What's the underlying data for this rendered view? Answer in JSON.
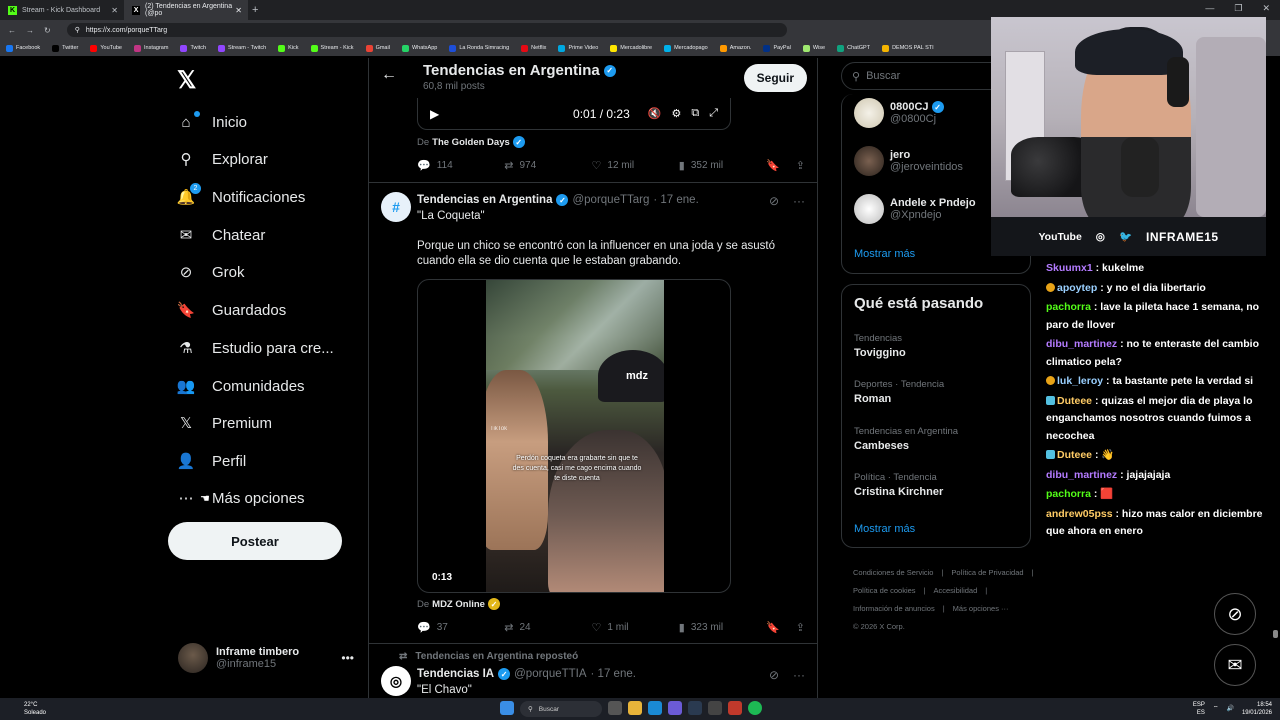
{
  "browser": {
    "tabs": [
      {
        "label": "Stream - Kick Dashboard",
        "active": false
      },
      {
        "label": "(2) Tendencias en Argentina (@po",
        "active": true
      }
    ],
    "url": "https://x.com/porqueTTarg",
    "bookmarks": [
      "Facebook",
      "Twitter",
      "YouTube",
      "Instagram",
      "Twitch",
      "Stream - Twitch",
      "Kick",
      "Stream - Kick",
      "Gmail",
      "WhatsApp",
      "La Ronda Simracing",
      "Netflix",
      "Prime Video",
      "Mercadolibre",
      "Mercadopago",
      "Amazon.",
      "PayPal",
      "Wise",
      "ChatGPT",
      "DEMOS PAL STI"
    ]
  },
  "nav": {
    "items": [
      {
        "label": "Inicio",
        "icon": "home-icon"
      },
      {
        "label": "Explorar",
        "icon": "search-icon"
      },
      {
        "label": "Notificaciones",
        "icon": "bell-icon",
        "badge": "2"
      },
      {
        "label": "Chatear",
        "icon": "mail-icon"
      },
      {
        "label": "Grok",
        "icon": "grok-icon"
      },
      {
        "label": "Guardados",
        "icon": "bookmark-icon"
      },
      {
        "label": "Estudio para cre...",
        "icon": "flask-icon"
      },
      {
        "label": "Comunidades",
        "icon": "people-icon"
      },
      {
        "label": "Premium",
        "icon": "x-icon"
      },
      {
        "label": "Perfil",
        "icon": "person-icon"
      },
      {
        "label": "Más opciones",
        "icon": "more-circle-icon"
      }
    ],
    "post_button": "Postear",
    "profile": {
      "name": "Inframe timbero",
      "handle": "@inframe15"
    }
  },
  "header": {
    "title": "Tendencias en Argentina",
    "subtitle": "60,8 mil posts",
    "follow": "Seguir"
  },
  "video1": {
    "time": "0:01 / 0:23",
    "source_prefix": "De",
    "source": "The Golden Days",
    "stats": {
      "replies": "114",
      "reposts": "974",
      "likes": "12 mil",
      "views": "352 mil"
    }
  },
  "tweet2": {
    "name": "Tendencias en Argentina",
    "handle": "@porqueTTarg",
    "date": "· 17 ene.",
    "line1": "\"La Coqueta\"",
    "line2": "Porque un chico se encontró con la influencer en una joda y se asustó cuando ella se dio cuenta que le estaban grabando.",
    "media": {
      "duration": "0:13",
      "overlay_logo": "mdz",
      "caption": "Perdón coqueta era grabarte sin que te des cuenta, casi me cago encima cuando te diste cuenta",
      "tiktok": "TikTok"
    },
    "source_prefix": "De",
    "source": "MDZ Online",
    "stats": {
      "replies": "37",
      "reposts": "24",
      "likes": "1 mil",
      "views": "323 mil"
    }
  },
  "tweet3": {
    "repost_label": "Tendencias en Argentina reposteó",
    "name": "Tendencias IA",
    "handle": "@porqueTTIA",
    "date": "· 17 ene.",
    "line1": "\"El Chavo\""
  },
  "right": {
    "search_placeholder": "Buscar",
    "who": [
      {
        "name": "0800CJ",
        "handle": "@0800Cj",
        "verified": true
      },
      {
        "name": "jero",
        "handle": "@jeroveintidos",
        "verified": false
      },
      {
        "name": "Andele x Pndejo",
        "handle": "@Xpndejo",
        "verified": false
      }
    ],
    "show_more": "Mostrar más",
    "trends_title": "Qué está pasando",
    "trends": [
      {
        "context": "Tendencias",
        "name": "Toviggino"
      },
      {
        "context": "Deportes · Tendencia",
        "name": "Roman"
      },
      {
        "context": "Tendencias en Argentina",
        "name": "Cambeses"
      },
      {
        "context": "Política · Tendencia",
        "name": "Cristina Kirchner"
      }
    ],
    "footer": [
      "Condiciones de Servicio",
      "|",
      "Política de Privacidad",
      "|",
      "Política de cookies",
      "|",
      "Accesibilidad",
      "|",
      "Información de anuncios",
      "|",
      "Más opciones ···",
      "© 2026 X Corp."
    ]
  },
  "stream": {
    "brand": "INFRAME15",
    "social": [
      "YouTube"
    ],
    "chat": [
      {
        "user": "Skuumx1",
        "text": ": kukelme",
        "color": "u1",
        "badges": ""
      },
      {
        "user": "apoytep",
        "text": ": y no el dia libertario",
        "color": "u4",
        "badges": "b"
      },
      {
        "user": "pachorra",
        "text": ": lave la pileta hace 1 semana, no paro de llover",
        "color": "u2",
        "badges": ""
      },
      {
        "user": "dibu_martinez",
        "text": ": no te enteraste del cambio climatico pela?",
        "color": "u1",
        "badges": ""
      },
      {
        "user": "luk_leroy",
        "text": ": ta bastante pete la verdad si",
        "color": "u4",
        "badges": "b"
      },
      {
        "user": "Duteee",
        "text": ": quizas el mejor dia de playa lo enganchamos nosotros cuando fuimos a necochea",
        "color": "u3",
        "badges": "s"
      },
      {
        "user": "Duteee",
        "text": ": 👋",
        "color": "u3",
        "badges": "s"
      },
      {
        "user": "dibu_martinez",
        "text": ": jajajajaja",
        "color": "u1",
        "badges": ""
      },
      {
        "user": "pachorra",
        "text": ": 🟥",
        "color": "u2",
        "badges": ""
      },
      {
        "user": "andrew05pss",
        "text": ": hizo mas calor en diciembre que ahora en enero",
        "color": "u3",
        "badges": ""
      }
    ]
  },
  "taskbar": {
    "weather_temp": "22°C",
    "weather_desc": "Soleado",
    "search": "Buscar",
    "lang": "ESP",
    "lang2": "ES",
    "time": "18:54",
    "date": "19/01/2026"
  }
}
